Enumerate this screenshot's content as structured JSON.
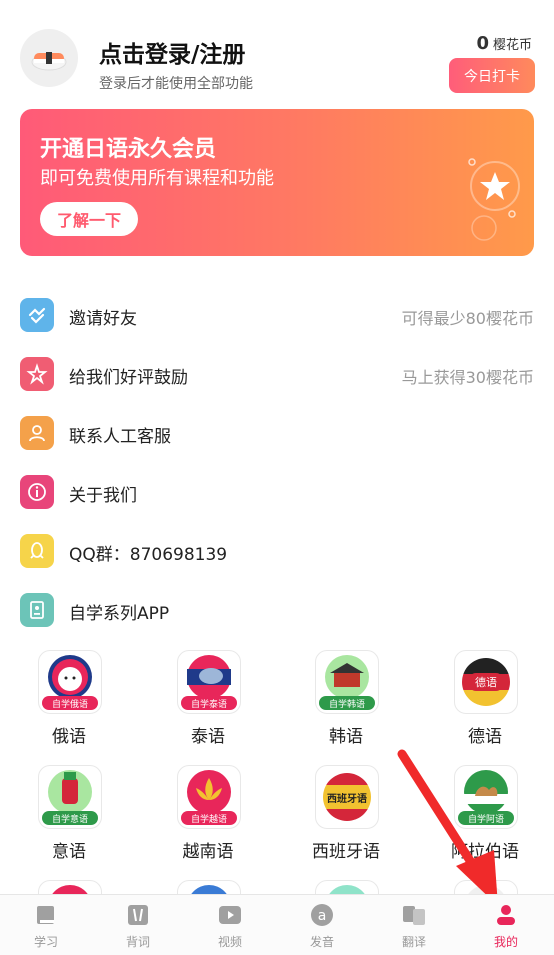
{
  "header": {
    "title": "点击登录/注册",
    "subtitle": "登录后才能使用全部功能",
    "coins_count": "0",
    "coins_label": "樱花币",
    "checkin_label": "今日打卡"
  },
  "banner": {
    "title": "开通日语永久会员",
    "subtitle": "即可免费使用所有课程和功能",
    "button": "了解一下"
  },
  "menu": [
    {
      "label": "邀请好友",
      "hint": "可得最少80樱花币",
      "icon": "handshake-icon",
      "color": "#5fb4ea"
    },
    {
      "label": "给我们好评鼓励",
      "hint": "马上获得30樱花币",
      "icon": "star-burst-icon",
      "color": "#f05d73"
    },
    {
      "label": "联系人工客服",
      "hint": "",
      "icon": "person-icon",
      "color": "#f4a14a"
    },
    {
      "label": "关于我们",
      "hint": "",
      "icon": "info-icon",
      "color": "#e8457a"
    },
    {
      "label": "QQ群：870698139",
      "hint": "",
      "icon": "qq-icon",
      "color": "#f6d44a"
    },
    {
      "label": "自学系列APP",
      "hint": "",
      "icon": "app-badge-icon",
      "color": "#6cc4b8"
    }
  ],
  "apps": [
    {
      "name": "俄语",
      "tag": "自学俄语"
    },
    {
      "name": "泰语",
      "tag": "自学泰语"
    },
    {
      "name": "韩语",
      "tag": "自学韩语"
    },
    {
      "name": "德语",
      "tag": "德语"
    },
    {
      "name": "意语",
      "tag": "自学意语"
    },
    {
      "name": "越南语",
      "tag": "自学越语"
    },
    {
      "name": "西班牙语",
      "tag": "西班牙语"
    },
    {
      "name": "阿拉伯语",
      "tag": "自学阿语"
    }
  ],
  "tabs": [
    {
      "label": "学习",
      "icon": "book-icon"
    },
    {
      "label": "背词",
      "icon": "word-card-icon"
    },
    {
      "label": "视频",
      "icon": "play-icon"
    },
    {
      "label": "发音",
      "icon": "pronunciation-icon"
    },
    {
      "label": "翻译",
      "icon": "translate-icon"
    },
    {
      "label": "我的",
      "icon": "profile-icon",
      "active": true
    }
  ],
  "colors": {
    "accent": "#e8265a",
    "banner_start": "#ff5a78",
    "banner_end": "#ff9a4a"
  }
}
